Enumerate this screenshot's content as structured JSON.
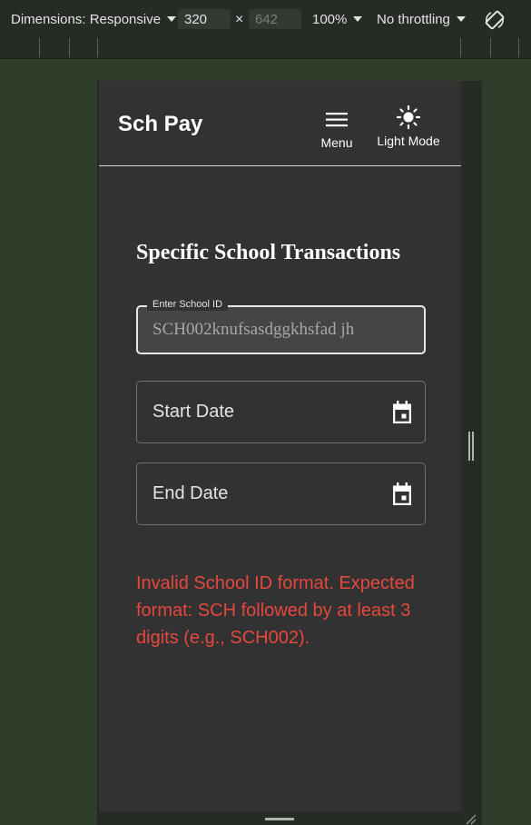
{
  "devtools": {
    "dimensions_label": "Dimensions: Responsive",
    "width_value": "320",
    "times_sign": "×",
    "height_placeholder": "642",
    "zoom": "100%",
    "throttling": "No throttling",
    "rotate_icon": "rotate-icon"
  },
  "app": {
    "brand": "Sch Pay",
    "menu_label": "Menu",
    "menu_icon": "hamburger-icon",
    "theme_label": "Light Mode",
    "theme_icon": "sun-icon"
  },
  "page": {
    "title": "Specific School Transactions",
    "school_id": {
      "label": "Enter School ID",
      "value": "SCH002knufsasdggkhsfad jh"
    },
    "start_date_label": "Start Date",
    "end_date_label": "End Date",
    "calendar_icon": "calendar-icon",
    "error_message": "Invalid School ID format. Expected format: SCH followed by at least 3 digits (e.g., SCH002)."
  },
  "colors": {
    "page_background": "#333233",
    "error": "#e5483d",
    "toolbar": "#262b26",
    "outside_viewport": "#2f3e2a"
  }
}
